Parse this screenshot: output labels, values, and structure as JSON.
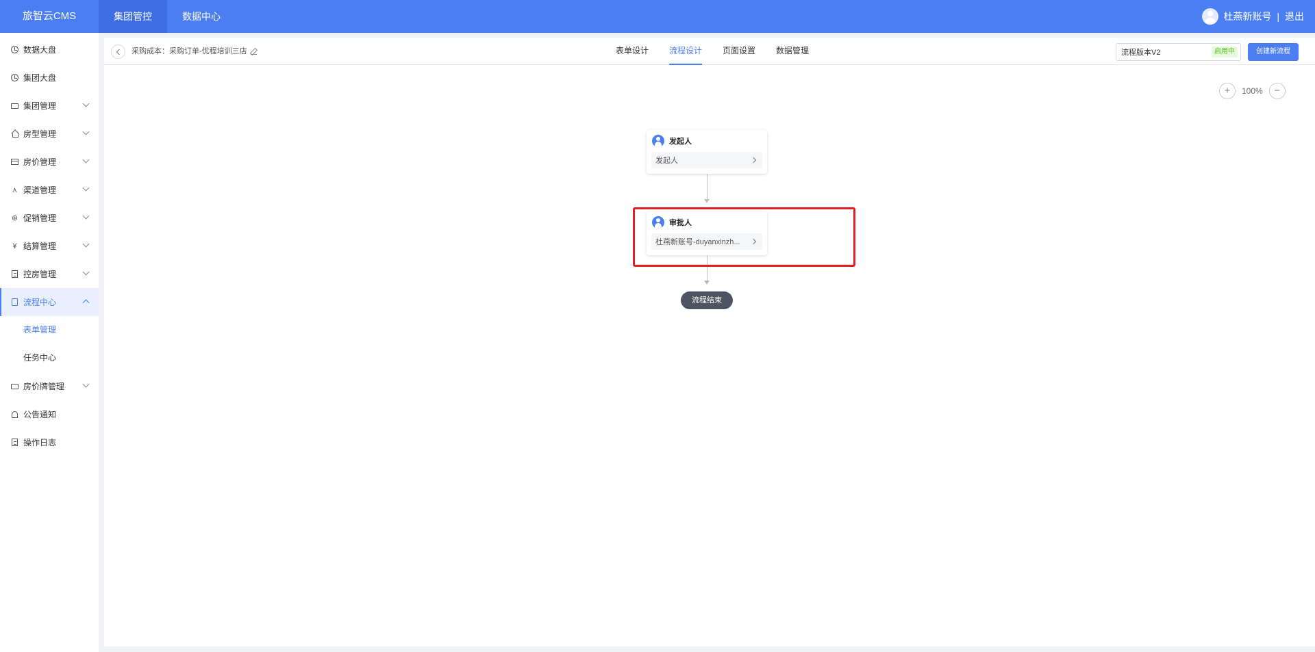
{
  "header": {
    "brand": "旅智云CMS",
    "nav": [
      {
        "label": "集团管控",
        "active": true
      },
      {
        "label": "数据中心",
        "active": false
      }
    ],
    "user_name": "杜燕新账号",
    "separator": "|",
    "logout": "退出"
  },
  "sidebar": {
    "items": [
      {
        "label": "数据大盘",
        "icon": "clock-icon"
      },
      {
        "label": "集团大盘",
        "icon": "clock-icon"
      },
      {
        "label": "集团管理",
        "icon": "monitor-icon"
      },
      {
        "label": "房型管理",
        "icon": "house-icon"
      },
      {
        "label": "房价管理",
        "icon": "card-icon"
      },
      {
        "label": "渠道管理",
        "icon": "share-icon"
      },
      {
        "label": "促销管理",
        "icon": "gift-icon"
      },
      {
        "label": "结算管理",
        "icon": "yen-icon"
      },
      {
        "label": "控房管理",
        "icon": "doc-icon"
      },
      {
        "label": "流程中心",
        "icon": "clipboard-icon",
        "active": true
      },
      {
        "label": "房价牌管理",
        "icon": "monitor-icon"
      },
      {
        "label": "公告通知",
        "icon": "bell-icon"
      },
      {
        "label": "操作日志",
        "icon": "doc-icon"
      }
    ],
    "sub_items": [
      {
        "label": "表单管理",
        "active": true
      },
      {
        "label": "任务中心",
        "active": false
      }
    ]
  },
  "toolbar": {
    "breadcrumb": "采购成本：采购订单-优程培训三店",
    "tabs": [
      {
        "label": "表单设计",
        "active": false
      },
      {
        "label": "流程设计",
        "active": true
      },
      {
        "label": "页面设置",
        "active": false
      },
      {
        "label": "数据管理",
        "active": false
      }
    ],
    "version": "流程版本V2",
    "version_status": "启用中",
    "create_button": "创建新流程"
  },
  "zoom": {
    "plus": "+",
    "level": "100%",
    "minus": "−"
  },
  "flow": {
    "initiator": {
      "title": "发起人",
      "value": "发起人"
    },
    "approver": {
      "title": "审批人",
      "value": "杜燕新账号-duyanxinzh..."
    },
    "end": "流程结束"
  },
  "colors": {
    "primary": "#4a7ef1",
    "highlight": "#e02020",
    "end_node": "#4d5563",
    "status_green": "#52c41a"
  }
}
